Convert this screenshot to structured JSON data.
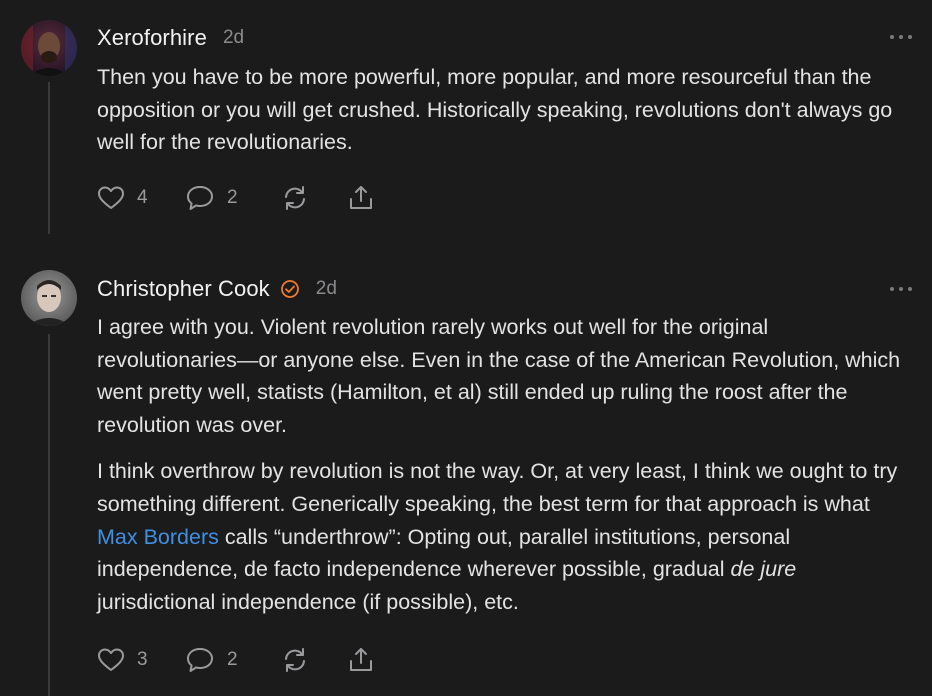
{
  "colors": {
    "background": "#1b1b1c",
    "text": "#e3e3e3",
    "muted": "#8b8b8e",
    "link": "#3f8fe3",
    "verified": "#f07b2c",
    "thread_line": "#3a3a3c"
  },
  "comments": [
    {
      "author": "Xeroforhire",
      "verified": false,
      "age": "2d",
      "body": [
        "Then you have to be more powerful, more popular, and more resourceful than the opposition or you will get crushed. Historically speaking, revolutions don't always go well for the revolutionaries."
      ],
      "likes": "4",
      "replies": "2",
      "icons": {
        "like": "heart-icon",
        "reply": "speech-bubble-icon",
        "restack": "restack-arrows-icon",
        "share": "share-upload-icon",
        "more": "more-dots-icon"
      }
    },
    {
      "author": "Christopher Cook",
      "verified": true,
      "age": "2d",
      "body_p1": "I agree with you. Violent revolution rarely works out well for the original revolutionaries—or anyone else. Even in the case of the American Revolution, which went pretty well, statists (Hamilton, et al) still ended up ruling the roost after the revolution was over.",
      "body_p2": {
        "before_link": "I think overthrow by revolution is not the way. Or, at very least, I think we ought to try something different. Generically speaking, the best term for that approach is what ",
        "link": "Max Borders",
        "after_link": " calls “underthrow”: Opting out, parallel institutions, personal independence, de facto independence wherever possible, gradual ",
        "italic": "de jure",
        "end": " jurisdictional independence (if possible), etc."
      },
      "likes": "3",
      "replies": "2",
      "icons": {
        "like": "heart-icon",
        "reply": "speech-bubble-icon",
        "restack": "restack-arrows-icon",
        "share": "share-upload-icon",
        "more": "more-dots-icon",
        "verified": "verified-check-icon"
      }
    }
  ]
}
